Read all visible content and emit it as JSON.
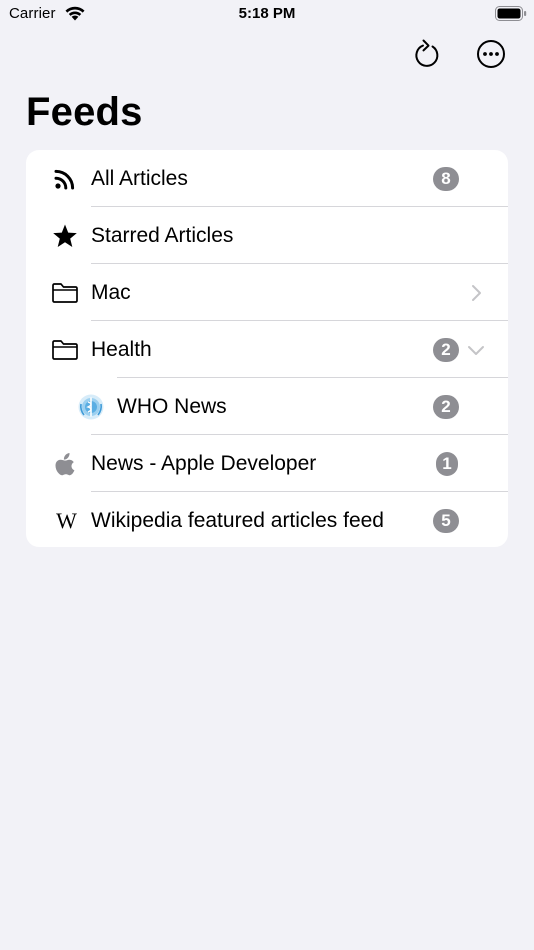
{
  "status_bar": {
    "carrier": "Carrier",
    "time": "5:18 PM"
  },
  "nav": {
    "refresh_icon": "refresh-icon",
    "more_icon": "more-icon"
  },
  "page": {
    "title": "Feeds"
  },
  "feeds": [
    {
      "label": "All Articles",
      "icon": "rss-icon",
      "badge": "8"
    },
    {
      "label": "Starred Articles",
      "icon": "star-icon"
    },
    {
      "label": "Mac",
      "icon": "folder-icon",
      "disclosure": "chevron-right"
    },
    {
      "label": "Health",
      "icon": "folder-icon",
      "badge": "2",
      "disclosure": "chevron-down"
    },
    {
      "label": "WHO News",
      "icon": "who-logo-icon",
      "badge": "2"
    },
    {
      "label": "News - Apple Developer",
      "icon": "apple-icon",
      "badge": "1"
    },
    {
      "label": "Wikipedia featured articles feed",
      "icon": "wikipedia-icon",
      "badge": "5"
    }
  ],
  "colors": {
    "background": "#f2f2f7",
    "card": "#ffffff",
    "badge": "#8e8e93",
    "separator": "#d6d6da",
    "chevron": "#c4c4c7"
  }
}
